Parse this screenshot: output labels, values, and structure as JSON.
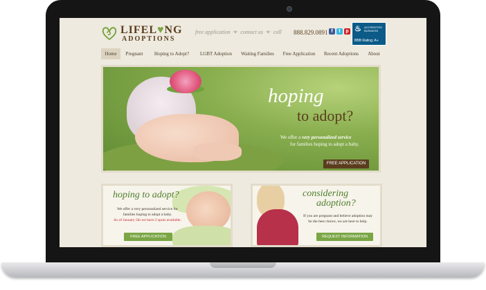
{
  "colors": {
    "brand_brown": "#5a3d1e",
    "brand_green": "#7ca544",
    "accent_red": "#c8202a"
  },
  "logo": {
    "top_pre": "LIFEL",
    "top_heart": "♥",
    "top_post": "NG",
    "bottom": "ADOPTIONS"
  },
  "header": {
    "tagline_1": "free application",
    "tagline_2": "contact us",
    "tagline_3": "call",
    "phone": "888.829.0891",
    "social": [
      {
        "name": "facebook-icon",
        "glyph": "f"
      },
      {
        "name": "twitter-icon",
        "glyph": "t"
      },
      {
        "name": "pinterest-icon",
        "glyph": "p"
      }
    ],
    "bbb": {
      "label": "BBB",
      "line1": "ACCREDITED",
      "line2": "BUSINESS",
      "rating": "Rating: A+"
    }
  },
  "nav": [
    {
      "label": "Home"
    },
    {
      "label": "Pregnant"
    },
    {
      "label": "Hoping to Adopt?"
    },
    {
      "label": "LGBT Adoption"
    },
    {
      "label": "Waiting Families"
    },
    {
      "label": "Free Application"
    },
    {
      "label": "Recent Adoptions"
    },
    {
      "label": "About"
    }
  ],
  "hero": {
    "title_1": "hoping",
    "title_2": "to adopt?",
    "line1_pre": "We offer a ",
    "line1_bold": "very personalized service",
    "line2": "for families hoping to adopt a baby.",
    "button": "FREE APPLICATION"
  },
  "panels": {
    "left": {
      "title": "hoping to adopt?",
      "text_1": "We offer a very personalized service for",
      "text_2": "families hoping to adopt a baby.",
      "text_red": "As of January 5th we have 2 spots available.",
      "button": "FREE APPLICATION"
    },
    "right": {
      "title_1": "considering",
      "title_2": "adoption?",
      "text_1": "If you are pregnant and believe adoption may",
      "text_2": "be the best choice, we are here to help.",
      "button": "REQUEST INFORMATION"
    }
  }
}
